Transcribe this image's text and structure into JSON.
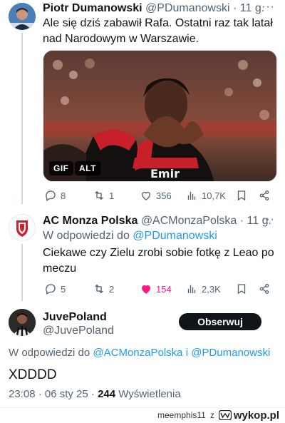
{
  "tweet1": {
    "name": "Piotr Dumanowski",
    "handle": "@PDumanowski",
    "time": "· 11 g.",
    "text": "Ale się dziś zabawił Rafa. Ostatni raz tak latał nad Narodowym w Warszawie.",
    "media_badge_gif": "GIF",
    "media_badge_alt": "ALT",
    "stats": {
      "replies": "8",
      "retweets": "1",
      "likes": "356",
      "views": "10,7K"
    }
  },
  "tweet2": {
    "name": "AC Monza Polska",
    "handle": "@ACMonzaPolska",
    "time": "· 11 g.",
    "reply_prefix": "W odpowiedzi do",
    "reply_handle": "@PDumanowski",
    "text": "Ciekawe czy Zielu zrobi sobie fotkę z Leao po meczu",
    "stats": {
      "replies": "5",
      "retweets": "2",
      "likes": "154",
      "views": "2,3K"
    }
  },
  "tweet3": {
    "name": "JuvePoland",
    "handle": "@JuvePoland",
    "follow_label": "Obserwuj",
    "reply_prefix": "W odpowiedzi do",
    "reply_handle_1": "@ACMonzaPolska",
    "reply_join": "i",
    "reply_handle_2": "@PDumanowski",
    "text": "XDDDD",
    "meta_time": "23:08 · 06 sty 25 ·",
    "meta_views_count": "244",
    "meta_views_label": "Wyświetlenia"
  },
  "watermark": {
    "user": "meemphis11",
    "z": "z",
    "site": "wykop.pl"
  },
  "colors": {
    "accent": "#1d9bf0",
    "like_active": "#f91880",
    "muted": "#536471",
    "text": "#0f1419"
  },
  "icons": [
    "more-icon",
    "reply-icon",
    "retweet-icon",
    "like-icon",
    "views-icon",
    "bookmark-icon",
    "share-icon",
    "wykop-logo-icon"
  ]
}
